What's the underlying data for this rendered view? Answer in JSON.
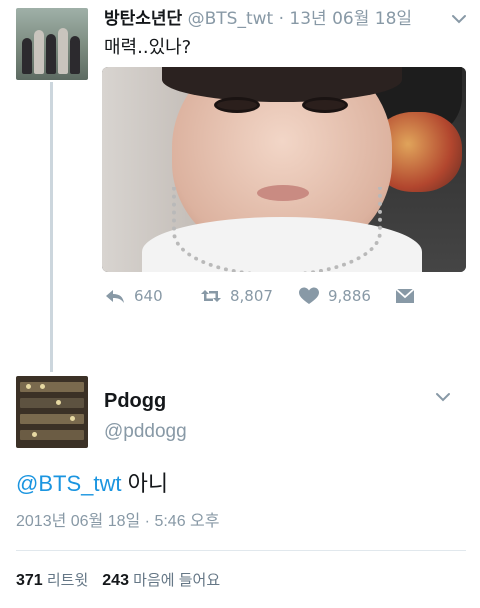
{
  "tweet1": {
    "name": "방탄소년단",
    "handle": "@BTS_twt",
    "separator": " · ",
    "date": "13년 06월 18일",
    "text": "매력..있나?",
    "actions": {
      "reply_count": "640",
      "retweet_count": "8,807",
      "like_count": "9,886"
    }
  },
  "tweet2": {
    "name": "Pdogg",
    "handle": "@pddogg",
    "mention": "@BTS_twt",
    "text": " 아니",
    "timestamp": "2013년 06월 18일 · 5:46 오후",
    "retweets_value": "371",
    "retweets_label": "리트윗",
    "likes_value": "243",
    "likes_label": "마음에 들어요"
  },
  "colors": {
    "accent": "#1b95e0",
    "muted": "#8899a6",
    "text": "#14171a",
    "thread": "#ccd6dd"
  }
}
